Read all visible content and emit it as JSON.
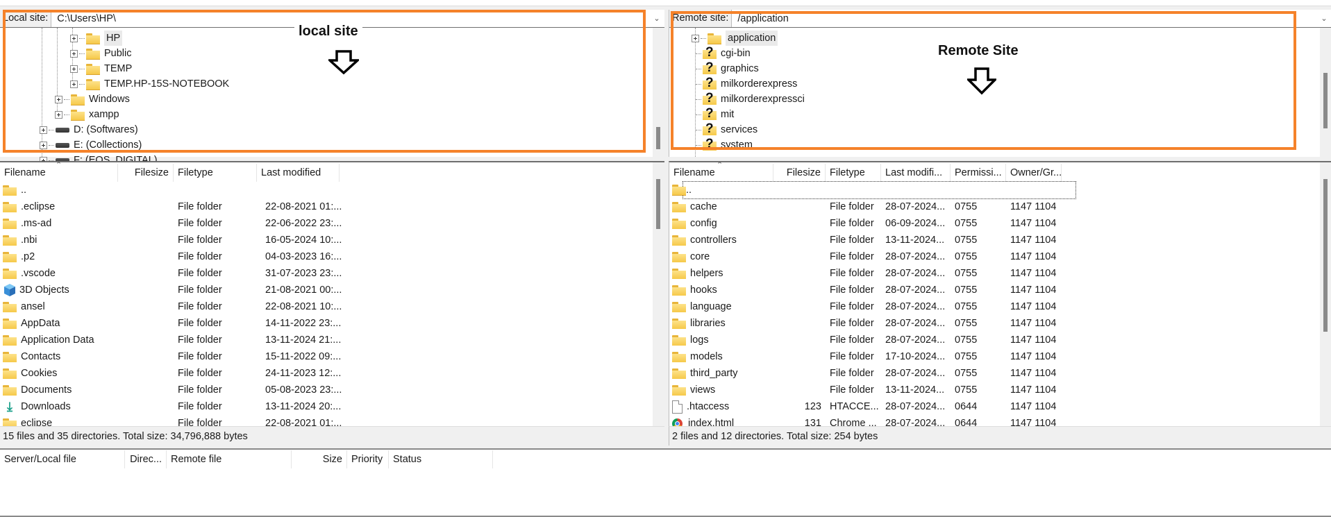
{
  "local": {
    "address_label": "Local site:",
    "address_value": "C:\\Users\\HP\\",
    "annotation": "local site",
    "tree": [
      {
        "label": "HP",
        "icon": "folder-icon",
        "level": 3,
        "selected": true
      },
      {
        "label": "Public",
        "icon": "folder-icon",
        "level": 3
      },
      {
        "label": "TEMP",
        "icon": "folder-icon",
        "level": 3
      },
      {
        "label": "TEMP.HP-15S-NOTEBOOK",
        "icon": "folder-icon",
        "level": 3
      },
      {
        "label": "Windows",
        "icon": "folder-icon",
        "level": 2
      },
      {
        "label": "xampp",
        "icon": "folder-icon",
        "level": 2
      },
      {
        "label": "D: (Softwares)",
        "icon": "drive-icon",
        "level": 1
      },
      {
        "label": "E: (Collections)",
        "icon": "drive-icon",
        "level": 1
      },
      {
        "label": "F: (EOS_DIGITAL)",
        "icon": "drive-icon",
        "level": 1
      }
    ],
    "columns": [
      "Filename",
      "Filesize",
      "Filetype",
      "Last modified"
    ],
    "files": [
      {
        "name": "..",
        "icon": "folder-icon",
        "size": "",
        "type": "",
        "modified": ""
      },
      {
        "name": ".eclipse",
        "icon": "folder-icon",
        "size": "",
        "type": "File folder",
        "modified": "22-08-2021 01:..."
      },
      {
        "name": ".ms-ad",
        "icon": "folder-icon",
        "size": "",
        "type": "File folder",
        "modified": "22-06-2022 23:..."
      },
      {
        "name": ".nbi",
        "icon": "folder-icon",
        "size": "",
        "type": "File folder",
        "modified": "16-05-2024 10:..."
      },
      {
        "name": ".p2",
        "icon": "folder-icon",
        "size": "",
        "type": "File folder",
        "modified": "04-03-2023 16:..."
      },
      {
        "name": ".vscode",
        "icon": "folder-icon",
        "size": "",
        "type": "File folder",
        "modified": "31-07-2023 23:..."
      },
      {
        "name": "3D Objects",
        "icon": "cube-icon",
        "size": "",
        "type": "File folder",
        "modified": "21-08-2021 00:..."
      },
      {
        "name": "ansel",
        "icon": "folder-icon",
        "size": "",
        "type": "File folder",
        "modified": "22-08-2021 10:..."
      },
      {
        "name": "AppData",
        "icon": "folder-icon",
        "size": "",
        "type": "File folder",
        "modified": "14-11-2022 23:..."
      },
      {
        "name": "Application Data",
        "icon": "folder-icon",
        "size": "",
        "type": "File folder",
        "modified": "13-11-2024 21:..."
      },
      {
        "name": "Contacts",
        "icon": "folder-icon",
        "size": "",
        "type": "File folder",
        "modified": "15-11-2022 09:..."
      },
      {
        "name": "Cookies",
        "icon": "folder-icon",
        "size": "",
        "type": "File folder",
        "modified": "24-11-2023 12:..."
      },
      {
        "name": "Documents",
        "icon": "folder-icon",
        "size": "",
        "type": "File folder",
        "modified": "05-08-2023 23:..."
      },
      {
        "name": "Downloads",
        "icon": "download-icon",
        "size": "",
        "type": "File folder",
        "modified": "13-11-2024 20:..."
      },
      {
        "name": "eclipse",
        "icon": "folder-icon",
        "size": "",
        "type": "File folder",
        "modified": "22-08-2021 01:..."
      }
    ],
    "status": "15 files and 35 directories. Total size: 34,796,888 bytes"
  },
  "remote": {
    "address_label": "Remote site:",
    "address_value": "/application",
    "annotation": "Remote Site",
    "tree": [
      {
        "label": "application",
        "icon": "folder-icon",
        "expandable": true,
        "selected": true
      },
      {
        "label": "cgi-bin",
        "icon": "unknown-folder-icon"
      },
      {
        "label": "graphics",
        "icon": "unknown-folder-icon"
      },
      {
        "label": "milkorderexpress",
        "icon": "unknown-folder-icon"
      },
      {
        "label": "milkorderexpressci",
        "icon": "unknown-folder-icon"
      },
      {
        "label": "mit",
        "icon": "unknown-folder-icon"
      },
      {
        "label": "services",
        "icon": "unknown-folder-icon"
      },
      {
        "label": "system",
        "icon": "unknown-folder-icon"
      }
    ],
    "columns": [
      "Filename",
      "Filesize",
      "Filetype",
      "Last modifi...",
      "Permissi...",
      "Owner/Gr..."
    ],
    "files": [
      {
        "name": "..",
        "icon": "folder-icon",
        "size": "",
        "type": "",
        "modified": "",
        "perms": "",
        "owner": ""
      },
      {
        "name": "cache",
        "icon": "folder-icon",
        "size": "",
        "type": "File folder",
        "modified": "28-07-2024...",
        "perms": "0755",
        "owner": "1147 1104"
      },
      {
        "name": "config",
        "icon": "folder-icon",
        "size": "",
        "type": "File folder",
        "modified": "06-09-2024...",
        "perms": "0755",
        "owner": "1147 1104"
      },
      {
        "name": "controllers",
        "icon": "folder-icon",
        "size": "",
        "type": "File folder",
        "modified": "13-11-2024...",
        "perms": "0755",
        "owner": "1147 1104"
      },
      {
        "name": "core",
        "icon": "folder-icon",
        "size": "",
        "type": "File folder",
        "modified": "28-07-2024...",
        "perms": "0755",
        "owner": "1147 1104"
      },
      {
        "name": "helpers",
        "icon": "folder-icon",
        "size": "",
        "type": "File folder",
        "modified": "28-07-2024...",
        "perms": "0755",
        "owner": "1147 1104"
      },
      {
        "name": "hooks",
        "icon": "folder-icon",
        "size": "",
        "type": "File folder",
        "modified": "28-07-2024...",
        "perms": "0755",
        "owner": "1147 1104"
      },
      {
        "name": "language",
        "icon": "folder-icon",
        "size": "",
        "type": "File folder",
        "modified": "28-07-2024...",
        "perms": "0755",
        "owner": "1147 1104"
      },
      {
        "name": "libraries",
        "icon": "folder-icon",
        "size": "",
        "type": "File folder",
        "modified": "28-07-2024...",
        "perms": "0755",
        "owner": "1147 1104"
      },
      {
        "name": "logs",
        "icon": "folder-icon",
        "size": "",
        "type": "File folder",
        "modified": "28-07-2024...",
        "perms": "0755",
        "owner": "1147 1104"
      },
      {
        "name": "models",
        "icon": "folder-icon",
        "size": "",
        "type": "File folder",
        "modified": "17-10-2024...",
        "perms": "0755",
        "owner": "1147 1104"
      },
      {
        "name": "third_party",
        "icon": "folder-icon",
        "size": "",
        "type": "File folder",
        "modified": "28-07-2024...",
        "perms": "0755",
        "owner": "1147 1104"
      },
      {
        "name": "views",
        "icon": "folder-icon",
        "size": "",
        "type": "File folder",
        "modified": "13-11-2024...",
        "perms": "0755",
        "owner": "1147 1104"
      },
      {
        "name": ".htaccess",
        "icon": "file-icon",
        "size": "123",
        "type": "HTACCE...",
        "modified": "28-07-2024...",
        "perms": "0644",
        "owner": "1147 1104"
      },
      {
        "name": "index.html",
        "icon": "chrome-icon",
        "size": "131",
        "type": "Chrome ...",
        "modified": "28-07-2024...",
        "perms": "0644",
        "owner": "1147 1104"
      }
    ],
    "status": "2 files and 12 directories. Total size: 254 bytes"
  },
  "queue": {
    "columns": [
      "Server/Local file",
      "Direc...",
      "Remote file",
      "Size",
      "Priority",
      "Status"
    ]
  },
  "colors": {
    "annotation_box": "#f5822a",
    "folder": "#f6c94a"
  }
}
